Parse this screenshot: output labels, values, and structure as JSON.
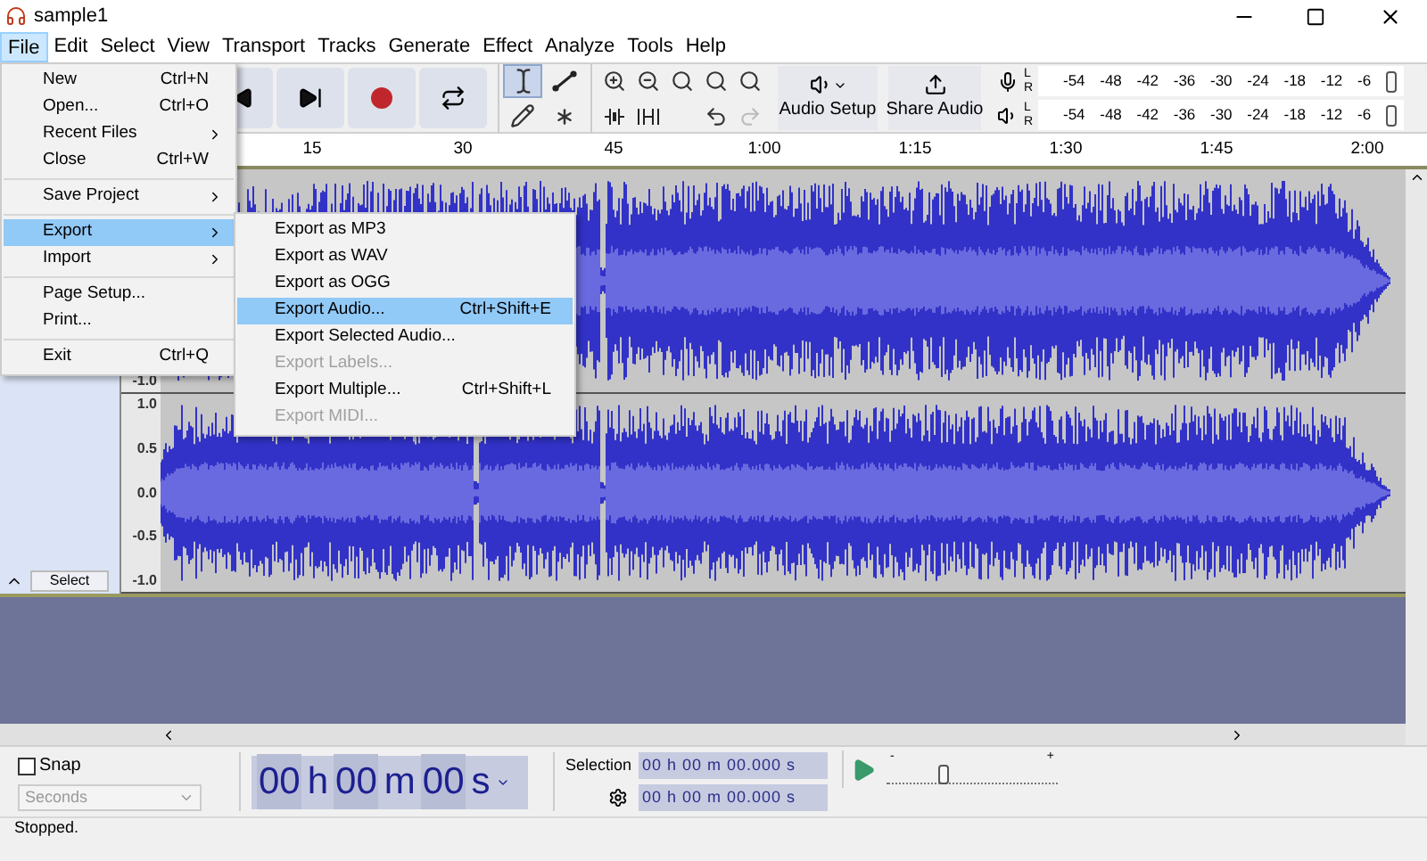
{
  "window": {
    "title": "sample1"
  },
  "menu_bar": [
    {
      "label": "File",
      "selected": true
    },
    {
      "label": "Edit",
      "selected": false
    },
    {
      "label": "Select",
      "selected": false
    },
    {
      "label": "View",
      "selected": false
    },
    {
      "label": "Transport",
      "selected": false
    },
    {
      "label": "Tracks",
      "selected": false
    },
    {
      "label": "Generate",
      "selected": false
    },
    {
      "label": "Effect",
      "selected": false
    },
    {
      "label": "Analyze",
      "selected": false
    },
    {
      "label": "Tools",
      "selected": false
    },
    {
      "label": "Help",
      "selected": false
    }
  ],
  "tools": [
    {
      "kind": "select",
      "selected": true
    },
    {
      "kind": "envelope",
      "selected": false
    },
    {
      "kind": "draw",
      "selected": false
    },
    {
      "kind": "multi",
      "selected": false
    }
  ],
  "edit_buttons": [
    {
      "kind": "undo",
      "disabled": false
    },
    {
      "kind": "redo",
      "disabled": true
    }
  ],
  "audio_setup": {
    "label": "Audio Setup"
  },
  "share_audio": {
    "label": "Share Audio"
  },
  "meters": [
    {
      "kind": "record",
      "channels": [
        "L",
        "R"
      ],
      "scale": [
        "-54",
        "-48",
        "-42",
        "-36",
        "-30",
        "-24",
        "-18",
        "-12",
        "-6"
      ]
    },
    {
      "kind": "playback",
      "channels": [
        "L",
        "R"
      ],
      "scale": [
        "-54",
        "-48",
        "-42",
        "-36",
        "-30",
        "-24",
        "-18",
        "-12",
        "-6"
      ]
    }
  ],
  "ruler": {
    "ticks": [
      "15",
      "30",
      "45",
      "1:00",
      "1:15",
      "1:30",
      "1:45",
      "2:00"
    ]
  },
  "track": {
    "select_button": "Select",
    "channels": [
      {
        "scale": [
          "-1.0"
        ]
      },
      {
        "scale": [
          "1.0",
          "0.5",
          "0.0",
          "-0.5",
          "-1.0"
        ]
      }
    ]
  },
  "snap": {
    "label": "Snap",
    "checked": false
  },
  "snap_unit": {
    "value": "Seconds",
    "disabled": true
  },
  "time": [
    {
      "digits": "00",
      "unit": "h"
    },
    {
      "digits": "00",
      "unit": "m"
    },
    {
      "digits": "00",
      "unit": "s"
    }
  ],
  "selection": {
    "label": "Selection",
    "fields": [
      "00 h 00 m 00.000 s",
      "00 h 00 m 00.000 s"
    ]
  },
  "play_speed": {
    "min_label": "-",
    "max_label": "+",
    "level": 0.33
  },
  "status_bar": {
    "text": "Stopped."
  },
  "file_menu": {
    "groups": [
      [
        {
          "label": "New",
          "shortcut": "Ctrl+N",
          "submenu": false,
          "selected": false
        },
        {
          "label": "Open...",
          "shortcut": "Ctrl+O",
          "submenu": false,
          "selected": false
        },
        {
          "label": "Recent Files",
          "submenu": true,
          "selected": false
        },
        {
          "label": "Close",
          "shortcut": "Ctrl+W",
          "submenu": false,
          "selected": false
        }
      ],
      [
        {
          "label": "Save Project",
          "submenu": true,
          "selected": false
        }
      ],
      [
        {
          "label": "Export",
          "submenu": true,
          "selected": true
        },
        {
          "label": "Import",
          "submenu": true,
          "selected": false
        }
      ],
      [
        {
          "label": "Page Setup...",
          "submenu": false,
          "selected": false
        },
        {
          "label": "Print...",
          "submenu": false,
          "selected": false
        }
      ],
      [
        {
          "label": "Exit",
          "shortcut": "Ctrl+Q",
          "submenu": false,
          "selected": false
        }
      ]
    ]
  },
  "export_submenu": {
    "items": [
      {
        "label": "Export as MP3",
        "disabled": false,
        "selected": false
      },
      {
        "label": "Export as WAV",
        "disabled": false,
        "selected": false
      },
      {
        "label": "Export as OGG",
        "disabled": false,
        "selected": false
      },
      {
        "label": "Export Audio...",
        "shortcut": "Ctrl+Shift+E",
        "disabled": false,
        "selected": true
      },
      {
        "label": "Export Selected Audio...",
        "disabled": false,
        "selected": false
      },
      {
        "label": "Export Labels...",
        "disabled": true,
        "selected": false
      },
      {
        "label": "Export Multiple...",
        "shortcut": "Ctrl+Shift+L",
        "disabled": false,
        "selected": false
      },
      {
        "label": "Export MIDI...",
        "disabled": true,
        "selected": false
      }
    ]
  }
}
